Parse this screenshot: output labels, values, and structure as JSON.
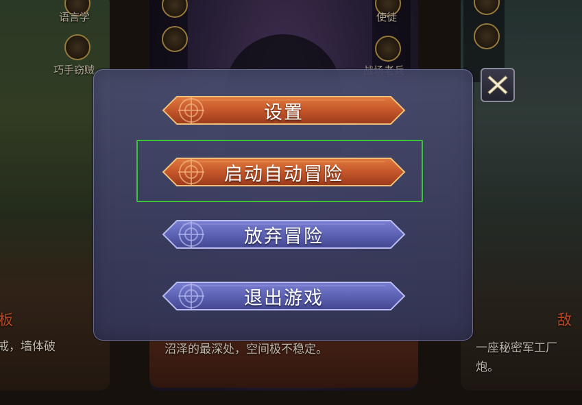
{
  "background": {
    "left_card": {
      "skill_labels": [
        "语言学",
        "巧手窃贼"
      ],
      "title_partial": "板",
      "desc_partial": "戒，墙体破"
    },
    "middle_card": {
      "desc": "沼泽的最深处，空间极不稳定。"
    },
    "right_strip_labels": [
      "使徒",
      "战场老兵"
    ],
    "right_card": {
      "title_partial": "敌",
      "desc_line1": "一座秘密军工厂",
      "desc_line2": "炮。"
    }
  },
  "dialog": {
    "close_icon": "close-x-icon",
    "buttons": [
      {
        "label": "设置",
        "style": "orange",
        "focused": false
      },
      {
        "label": "启动自动冒险",
        "style": "orange",
        "focused": true
      },
      {
        "label": "放弃冒险",
        "style": "blue",
        "focused": false
      },
      {
        "label": "退出游戏",
        "style": "blue",
        "focused": false
      }
    ],
    "colors": {
      "orange_button": "#c8582a",
      "blue_button": "#5f63b8",
      "focus_ring": "#3ec23a",
      "panel": "#4a4e70"
    }
  }
}
